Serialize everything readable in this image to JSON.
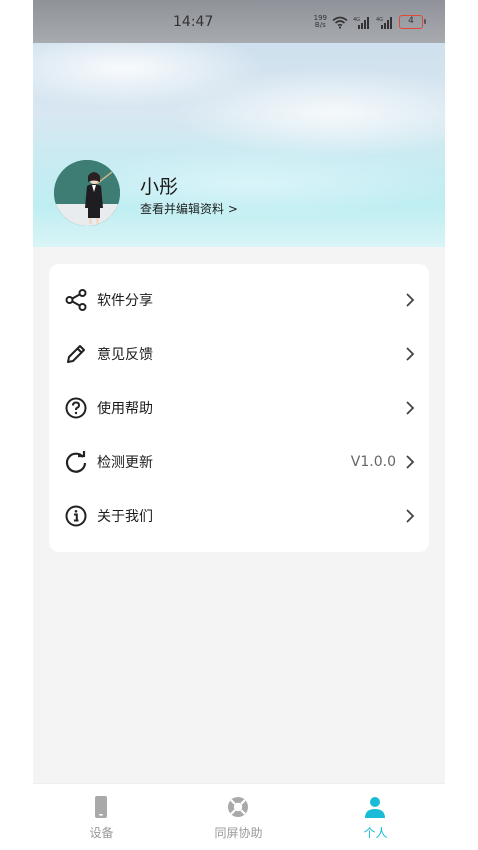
{
  "status_bar": {
    "time": "14:47",
    "net_speed_value": "199",
    "net_speed_unit": "B/s",
    "battery": "4",
    "icons": [
      "wifi-icon",
      "signal-4g-icon",
      "signal-4g-icon"
    ]
  },
  "profile": {
    "name": "小彤",
    "edit_link": "查看并编辑资料 >"
  },
  "menu": {
    "items": [
      {
        "label": "软件分享",
        "icon": "share-icon"
      },
      {
        "label": "意见反馈",
        "icon": "pencil-icon"
      },
      {
        "label": "使用帮助",
        "icon": "help-icon"
      },
      {
        "label": "检测更新",
        "icon": "refresh-icon",
        "value": "V1.0.0"
      },
      {
        "label": "关于我们",
        "icon": "info-icon"
      }
    ]
  },
  "tabbar": {
    "tabs": [
      {
        "label": "设备",
        "icon": "phone-device-icon"
      },
      {
        "label": "同屏协助",
        "icon": "lifebuoy-icon"
      },
      {
        "label": "个人",
        "icon": "person-icon",
        "active": true
      }
    ],
    "active_color": "#18bcd6",
    "inactive_color": "#999999"
  }
}
